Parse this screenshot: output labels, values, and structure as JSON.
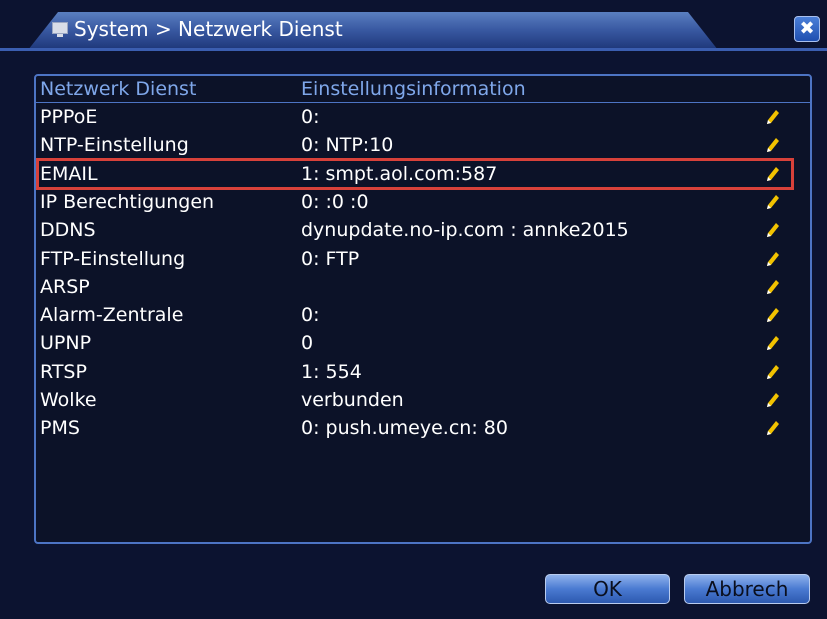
{
  "window": {
    "title": "System > Netzwerk Dienst",
    "close_glyph": "✖"
  },
  "table": {
    "headers": [
      "Netzwerk Dienst",
      "Einstellungsinformation"
    ],
    "rows": [
      {
        "service": "PPPoE",
        "info": "0:"
      },
      {
        "service": "NTP-Einstellung",
        "info": "0: NTP:10"
      },
      {
        "service": "EMAIL",
        "info": "1: smpt.aol.com:587"
      },
      {
        "service": "IP Berechtigungen",
        "info": "0: :0 :0"
      },
      {
        "service": "DDNS",
        "info": "dynupdate.no-ip.com : annke2015"
      },
      {
        "service": "FTP-Einstellung",
        "info": "0: FTP"
      },
      {
        "service": "ARSP",
        "info": ""
      },
      {
        "service": "Alarm-Zentrale",
        "info": "0:"
      },
      {
        "service": "UPNP",
        "info": "0"
      },
      {
        "service": "RTSP",
        "info": "1: 554"
      },
      {
        "service": "Wolke",
        "info": "verbunden"
      },
      {
        "service": "PMS",
        "info": "0: push.umeye.cn: 80"
      }
    ],
    "highlighted_row_index": 2,
    "edit_icon": "pencil-icon"
  },
  "buttons": {
    "ok": "OK",
    "cancel": "Abbrech"
  },
  "colors": {
    "background": "#0c1330",
    "header_text": "#7fa7ea",
    "highlight": "#d8413a",
    "pencil": "#f2c200"
  }
}
